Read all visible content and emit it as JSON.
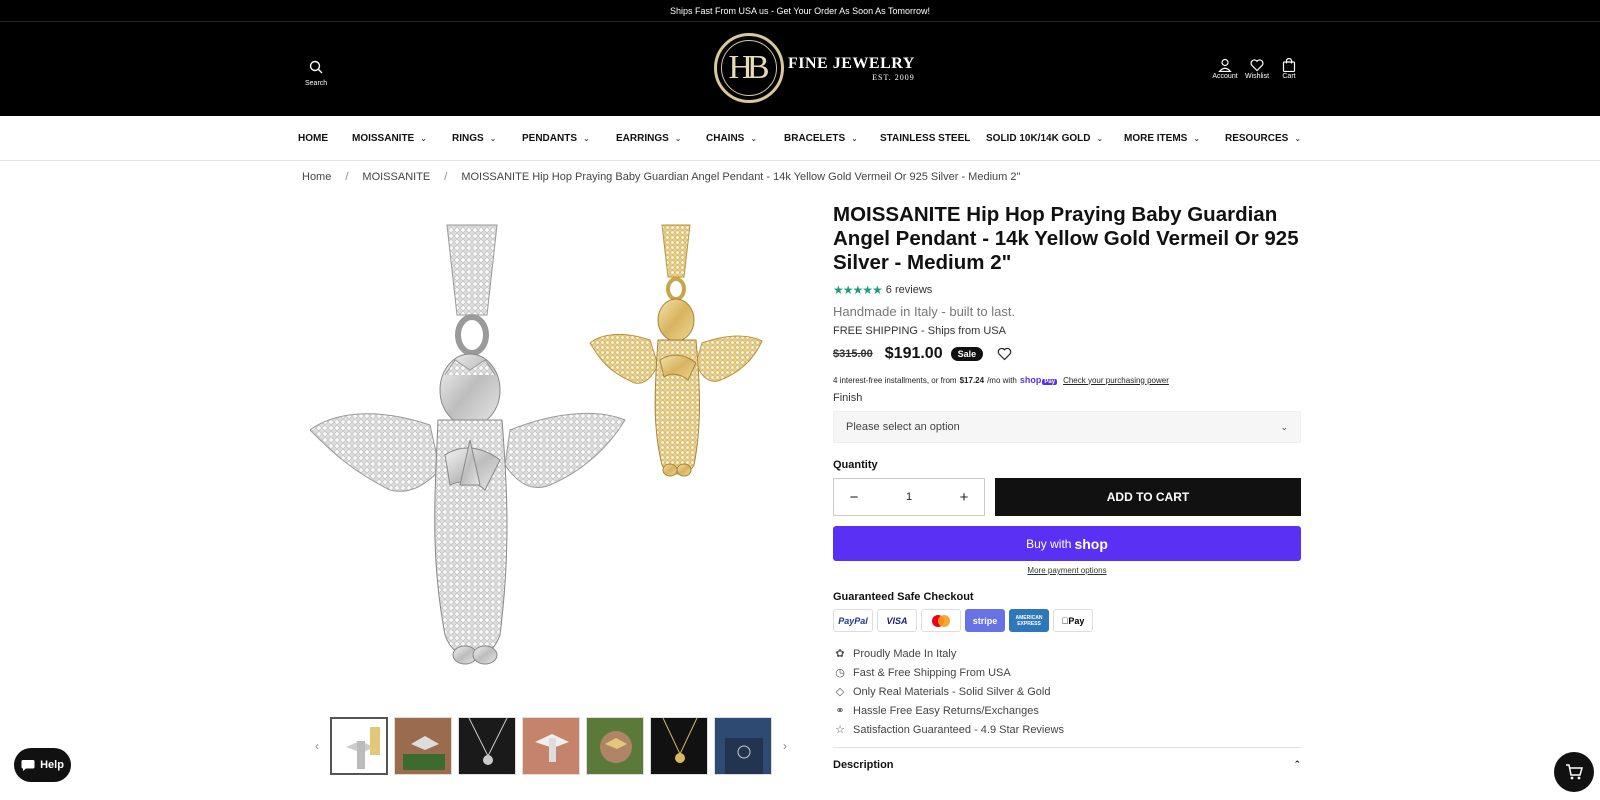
{
  "announcement": "Ships Fast From USA us - Get Your Order As Soon As Tomorrow!",
  "header": {
    "search_label": "Search",
    "logo_mono": "HB",
    "logo_name": "FINE JEWELRY",
    "logo_est": "EST. 2009",
    "account_label": "Account",
    "wishlist_label": "Wishlist",
    "cart_label": "Cart"
  },
  "nav": [
    {
      "label": "HOME",
      "dropdown": false
    },
    {
      "label": "MOISSANITE",
      "dropdown": true
    },
    {
      "label": "RINGS",
      "dropdown": true
    },
    {
      "label": "PENDANTS",
      "dropdown": true
    },
    {
      "label": "EARRINGS",
      "dropdown": true
    },
    {
      "label": "CHAINS",
      "dropdown": true
    },
    {
      "label": "BRACELETS",
      "dropdown": true
    },
    {
      "label": "STAINLESS STEEL",
      "dropdown": false
    },
    {
      "label": "SOLID 10K/14K GOLD",
      "dropdown": true
    },
    {
      "label": "MORE ITEMS",
      "dropdown": true
    },
    {
      "label": "RESOURCES",
      "dropdown": true
    }
  ],
  "breadcrumb": {
    "home": "Home",
    "category": "MOISSANITE",
    "current": "MOISSANITE Hip Hop Praying Baby Guardian Angel Pendant - 14k Yellow Gold Vermeil Or 925 Silver - Medium 2\""
  },
  "product": {
    "title": "MOISSANITE Hip Hop Praying Baby Guardian Angel Pendant - 14k Yellow Gold Vermeil Or 925 Silver - Medium 2\"",
    "rating": 5,
    "reviews": "6 reviews",
    "subtitle": "Handmade in Italy - built to last.",
    "shipping": "FREE SHIPPING - Ships from USA",
    "compare_price": "$315.00",
    "price": "$191.00",
    "badge": "Sale",
    "installments_pre": "4 interest-free installments, or from",
    "installments_amount": "$17.24",
    "installments_post": "/mo with",
    "shop_brand": "shop",
    "shop_pay": "Pay",
    "installments_link": "Check your purchasing power",
    "finish_label": "Finish",
    "finish_placeholder": "Please select an option",
    "quantity_label": "Quantity",
    "quantity": "1",
    "add_to_cart": "ADD TO CART",
    "buy_with": "Buy with",
    "buy_shop": "shop",
    "more_payment": "More payment options",
    "safe_checkout": "Guaranteed Safe Checkout",
    "payment_methods": [
      "PayPal",
      "VISA",
      "mastercard",
      "stripe",
      "AMERICAN EXPRESS",
      "Pay"
    ],
    "features": [
      {
        "icon": "award-icon",
        "text": "Proudly Made In Italy"
      },
      {
        "icon": "clock-icon",
        "text": "Fast & Free Shipping From USA"
      },
      {
        "icon": "diamond-icon",
        "text": "Only Real Materials - Solid Silver & Gold"
      },
      {
        "icon": "globe-icon",
        "text": "Hassle Free Easy Returns/Exchanges"
      },
      {
        "icon": "star-icon",
        "text": "Satisfaction Guaranteed - 4.9 Star Reviews"
      }
    ],
    "description_label": "Description"
  },
  "help_label": "Help",
  "colors": {
    "star": "#1a9e7d",
    "shop_purple": "#5a31f4",
    "header_bg": "#000000",
    "gold": "#d9c89a"
  }
}
